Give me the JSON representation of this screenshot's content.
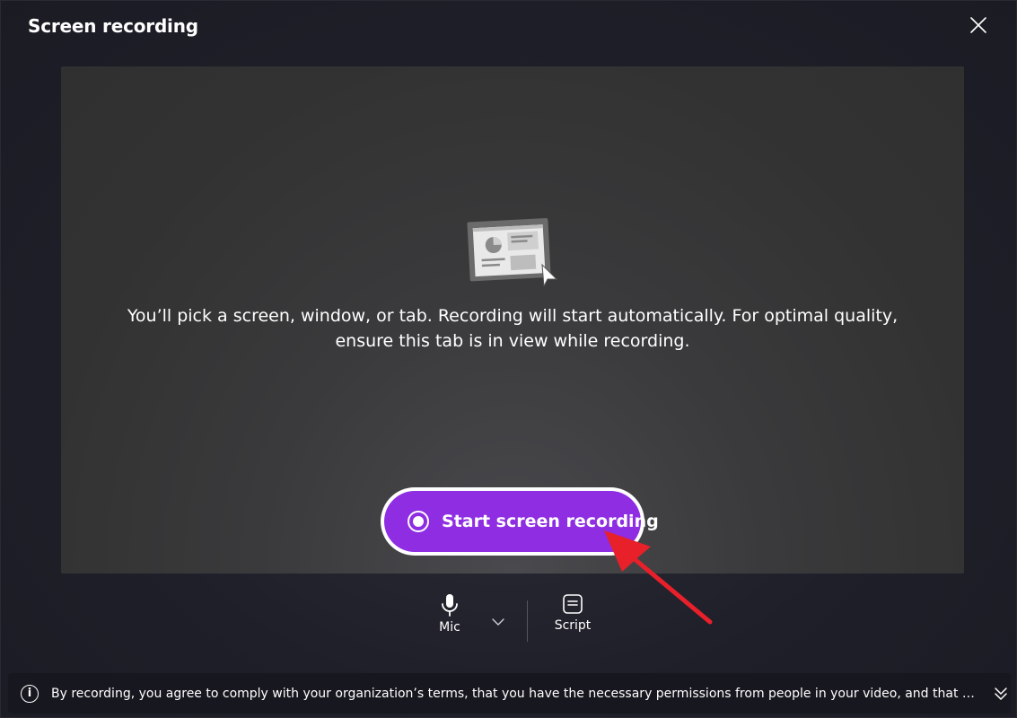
{
  "dialog": {
    "title": "Screen recording"
  },
  "preview": {
    "message": "You’ll pick a screen, window, or tab. Recording will start automatically. For optimal quality, ensure this tab is in view while recording.",
    "start_button_label": "Start screen recording"
  },
  "toolbar": {
    "mic_label": "Mic",
    "script_label": "Script"
  },
  "footer": {
    "disclaimer": "By recording, you agree to comply with your organization’s terms, that you have the necessary permissions from people in your video, and that you will re..."
  },
  "colors": {
    "accent": "#8e2de2",
    "annotation_arrow": "#e8202a",
    "background": "#1c1c25",
    "preview_bg": "#333333"
  },
  "icons": [
    "close-icon",
    "screen-illustration-icon",
    "record-icon",
    "mic-icon",
    "chevron-down-icon",
    "script-icon",
    "info-icon",
    "expand-down-icon"
  ]
}
